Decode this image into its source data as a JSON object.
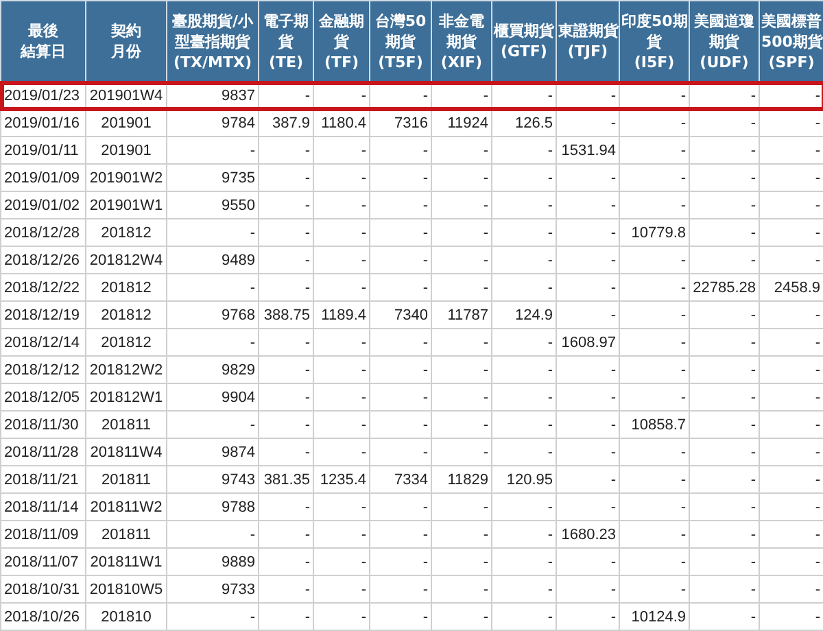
{
  "table": {
    "columns": [
      {
        "lines": [
          "最後",
          "結算日"
        ]
      },
      {
        "lines": [
          "契約",
          "月份"
        ]
      },
      {
        "lines": [
          "臺股期貨/小",
          "型臺指期貨",
          "(TX/MTX)"
        ]
      },
      {
        "lines": [
          "電子期",
          "貨",
          "(TE)"
        ]
      },
      {
        "lines": [
          "金融期",
          "貨",
          "(TF)"
        ]
      },
      {
        "lines": [
          "台灣50",
          "期貨",
          "(T5F)"
        ]
      },
      {
        "lines": [
          "非金電",
          "期貨",
          "(XIF)"
        ]
      },
      {
        "lines": [
          "櫃買期貨",
          "(GTF)"
        ]
      },
      {
        "lines": [
          "東證期貨",
          "(TJF)"
        ]
      },
      {
        "lines": [
          "印度50期",
          "貨",
          "(I5F)"
        ]
      },
      {
        "lines": [
          "美國道瓊",
          "期貨",
          "(UDF)"
        ]
      },
      {
        "lines": [
          "美國標普",
          "500期貨",
          "(SPF)"
        ]
      }
    ],
    "rows": [
      {
        "highlighted": true,
        "cells": [
          "2019/01/23",
          "201901W4",
          "9837",
          "-",
          "-",
          "-",
          "-",
          "-",
          "-",
          "-",
          "-",
          "-"
        ]
      },
      {
        "highlighted": false,
        "cells": [
          "2019/01/16",
          "201901",
          "9784",
          "387.9",
          "1180.4",
          "7316",
          "11924",
          "126.5",
          "-",
          "-",
          "-",
          "-"
        ]
      },
      {
        "highlighted": false,
        "cells": [
          "2019/01/11",
          "201901",
          "-",
          "-",
          "-",
          "-",
          "-",
          "-",
          "1531.94",
          "-",
          "-",
          "-"
        ]
      },
      {
        "highlighted": false,
        "cells": [
          "2019/01/09",
          "201901W2",
          "9735",
          "-",
          "-",
          "-",
          "-",
          "-",
          "-",
          "-",
          "-",
          "-"
        ]
      },
      {
        "highlighted": false,
        "cells": [
          "2019/01/02",
          "201901W1",
          "9550",
          "-",
          "-",
          "-",
          "-",
          "-",
          "-",
          "-",
          "-",
          "-"
        ]
      },
      {
        "highlighted": false,
        "cells": [
          "2018/12/28",
          "201812",
          "-",
          "-",
          "-",
          "-",
          "-",
          "-",
          "-",
          "10779.8",
          "-",
          "-"
        ]
      },
      {
        "highlighted": false,
        "cells": [
          "2018/12/26",
          "201812W4",
          "9489",
          "-",
          "-",
          "-",
          "-",
          "-",
          "-",
          "-",
          "-",
          "-"
        ]
      },
      {
        "highlighted": false,
        "cells": [
          "2018/12/22",
          "201812",
          "-",
          "-",
          "-",
          "-",
          "-",
          "-",
          "-",
          "-",
          "22785.28",
          "2458.9"
        ]
      },
      {
        "highlighted": false,
        "cells": [
          "2018/12/19",
          "201812",
          "9768",
          "388.75",
          "1189.4",
          "7340",
          "11787",
          "124.9",
          "-",
          "-",
          "-",
          "-"
        ]
      },
      {
        "highlighted": false,
        "cells": [
          "2018/12/14",
          "201812",
          "-",
          "-",
          "-",
          "-",
          "-",
          "-",
          "1608.97",
          "-",
          "-",
          "-"
        ]
      },
      {
        "highlighted": false,
        "cells": [
          "2018/12/12",
          "201812W2",
          "9829",
          "-",
          "-",
          "-",
          "-",
          "-",
          "-",
          "-",
          "-",
          "-"
        ]
      },
      {
        "highlighted": false,
        "cells": [
          "2018/12/05",
          "201812W1",
          "9904",
          "-",
          "-",
          "-",
          "-",
          "-",
          "-",
          "-",
          "-",
          "-"
        ]
      },
      {
        "highlighted": false,
        "cells": [
          "2018/11/30",
          "201811",
          "-",
          "-",
          "-",
          "-",
          "-",
          "-",
          "-",
          "10858.7",
          "-",
          "-"
        ]
      },
      {
        "highlighted": false,
        "cells": [
          "2018/11/28",
          "201811W4",
          "9874",
          "-",
          "-",
          "-",
          "-",
          "-",
          "-",
          "-",
          "-",
          "-"
        ]
      },
      {
        "highlighted": false,
        "cells": [
          "2018/11/21",
          "201811",
          "9743",
          "381.35",
          "1235.4",
          "7334",
          "11829",
          "120.95",
          "-",
          "-",
          "-",
          "-"
        ]
      },
      {
        "highlighted": false,
        "cells": [
          "2018/11/14",
          "201811W2",
          "9788",
          "-",
          "-",
          "-",
          "-",
          "-",
          "-",
          "-",
          "-",
          "-"
        ]
      },
      {
        "highlighted": false,
        "cells": [
          "2018/11/09",
          "201811",
          "-",
          "-",
          "-",
          "-",
          "-",
          "-",
          "1680.23",
          "-",
          "-",
          "-"
        ]
      },
      {
        "highlighted": false,
        "cells": [
          "2018/11/07",
          "201811W1",
          "9889",
          "-",
          "-",
          "-",
          "-",
          "-",
          "-",
          "-",
          "-",
          "-"
        ]
      },
      {
        "highlighted": false,
        "cells": [
          "2018/10/31",
          "201810W5",
          "9733",
          "-",
          "-",
          "-",
          "-",
          "-",
          "-",
          "-",
          "-",
          "-"
        ]
      },
      {
        "highlighted": false,
        "cells": [
          "2018/10/26",
          "201810",
          "-",
          "-",
          "-",
          "-",
          "-",
          "-",
          "-",
          "10124.9",
          "-",
          "-"
        ]
      }
    ]
  }
}
